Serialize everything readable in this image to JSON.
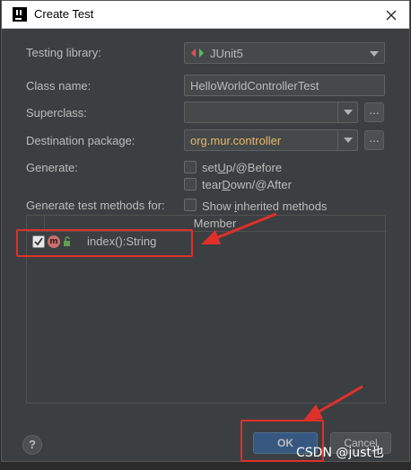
{
  "window": {
    "title": "Create Test"
  },
  "form": {
    "testing_library_label": "Testing library:",
    "testing_library_value": "JUnit5",
    "class_name_label": "Class name:",
    "class_name_value": "HelloWorldControllerTest",
    "superclass_label": "Superclass:",
    "superclass_value": "",
    "destination_label": "Destination package:",
    "destination_value": "org.mur.controller",
    "generate_label": "Generate:",
    "setup_option": {
      "pre": "set",
      "u": "U",
      "post": "p/@Before",
      "checked": false
    },
    "teardown_option": {
      "pre": "tear",
      "u": "D",
      "post": "own/@After",
      "checked": false
    },
    "methods_label": "Generate test methods for:",
    "show_inherited": {
      "pre": "Show ",
      "u": "i",
      "post": "nherited methods",
      "checked": false
    },
    "dots_label": "..."
  },
  "table": {
    "column_header": "Member",
    "rows": [
      {
        "method": "index():String",
        "checked": true,
        "icon_letter": "m"
      }
    ]
  },
  "buttons": {
    "help": "?",
    "ok": "OK",
    "cancel": "Cancel"
  },
  "watermark": "CSDN @just也",
  "colors": {
    "accent_highlight": "#e0302a",
    "destination_text": "#e8b96a",
    "ok_button": "#365880"
  },
  "icons": [
    "close-icon",
    "junit-icon",
    "chevron-down-icon",
    "method-icon",
    "lock-icon",
    "help-icon"
  ]
}
